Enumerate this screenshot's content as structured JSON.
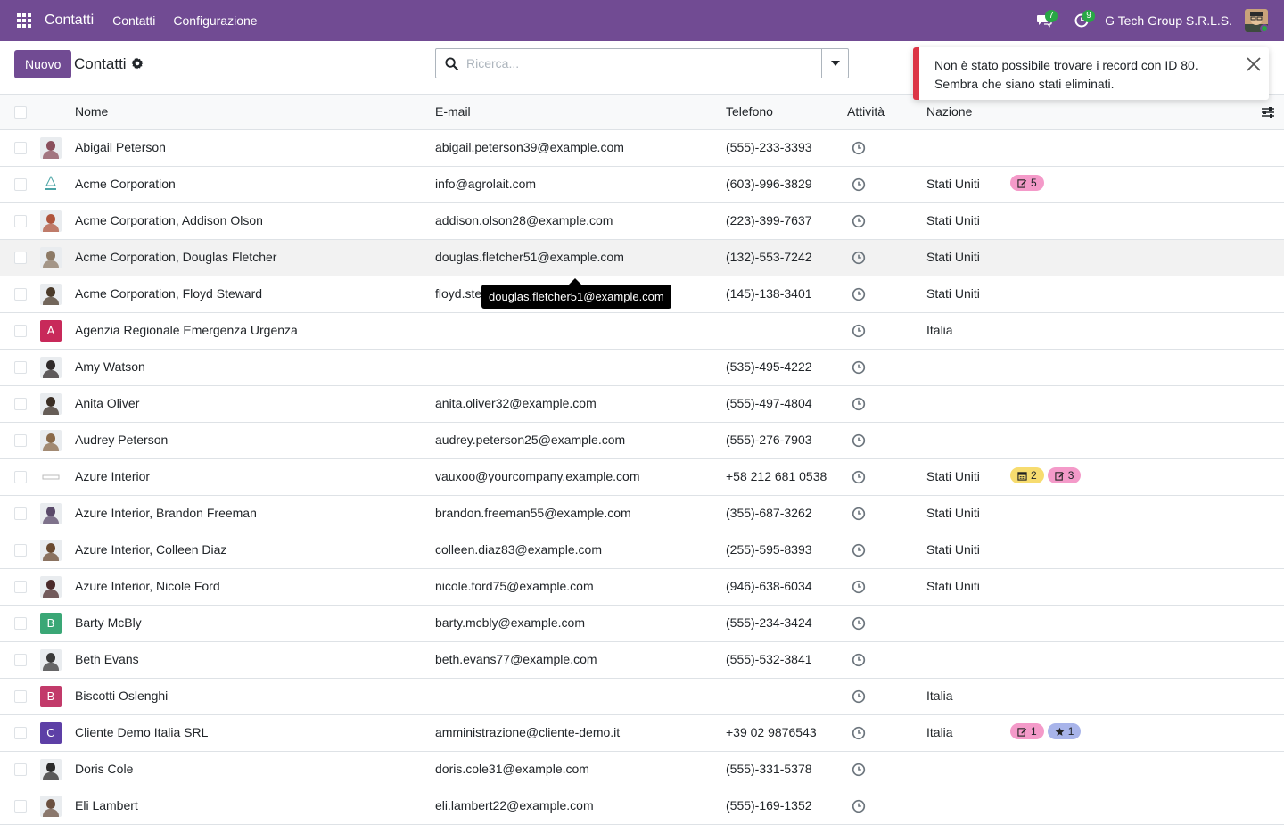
{
  "navbar": {
    "brand": "Contatti",
    "menu": [
      "Contatti",
      "Configurazione"
    ],
    "messages_count": "7",
    "activities_count": "9",
    "company": "G Tech Group S.R.L.S."
  },
  "control_panel": {
    "new_button": "Nuovo",
    "title": "Contatti",
    "search_placeholder": "Ricerca..."
  },
  "notification": {
    "message": "Non è stato possibile trovare i record con ID 80. Sembra che siano stati eliminati."
  },
  "table": {
    "headers": {
      "name": "Nome",
      "email": "E-mail",
      "phone": "Telefono",
      "activity": "Attività",
      "country": "Nazione"
    },
    "rows": [
      {
        "name": "Abigail Peterson",
        "email": "abigail.peterson39@example.com",
        "phone": "(555)-233-3393",
        "country": "",
        "avatar": "photo",
        "color": "#8a4f5c",
        "tags": []
      },
      {
        "name": "Acme Corporation",
        "email": "info@agrolait.com",
        "phone": "(603)-996-3829",
        "country": "Stati Uniti",
        "avatar": "logo-acme",
        "color": "#4aa3a5",
        "tags": [
          {
            "icon": "edit-icon",
            "text": "5",
            "color": "pink"
          }
        ]
      },
      {
        "name": "Acme Corporation, Addison Olson",
        "email": "addison.olson28@example.com",
        "phone": "(223)-399-7637",
        "country": "Stati Uniti",
        "avatar": "photo",
        "color": "#b0553d",
        "tags": []
      },
      {
        "name": "Acme Corporation, Douglas Fletcher",
        "email": "douglas.fletcher51@example.com",
        "phone": "(132)-553-7242",
        "country": "Stati Uniti",
        "avatar": "photo",
        "color": "#8c7a66",
        "tags": [],
        "hover": true
      },
      {
        "name": "Acme Corporation, Floyd Steward",
        "email": "floyd.steward34@example.com",
        "phone": "(145)-138-3401",
        "country": "Stati Uniti",
        "avatar": "photo",
        "color": "#4a3a2a",
        "tags": []
      },
      {
        "name": "Agenzia Regionale Emergenza Urgenza",
        "email": "",
        "phone": "",
        "country": "Italia",
        "avatar": "letter",
        "letter": "A",
        "color": "#c8295a",
        "tags": []
      },
      {
        "name": "Amy Watson",
        "email": "",
        "phone": "(535)-495-4222",
        "country": "",
        "avatar": "photo",
        "color": "#2f2a2a",
        "tags": []
      },
      {
        "name": "Anita Oliver",
        "email": "anita.oliver32@example.com",
        "phone": "(555)-497-4804",
        "country": "",
        "avatar": "photo",
        "color": "#3a2e24",
        "tags": []
      },
      {
        "name": "Audrey Peterson",
        "email": "audrey.peterson25@example.com",
        "phone": "(555)-276-7903",
        "country": "",
        "avatar": "photo",
        "color": "#8a6a4a",
        "tags": []
      },
      {
        "name": "Azure Interior",
        "email": "vauxoo@yourcompany.example.com",
        "phone": "+58 212 681 0538",
        "country": "Stati Uniti",
        "avatar": "logo-azure",
        "color": "#bbbbbb",
        "tags": [
          {
            "icon": "calendar-icon",
            "text": "2",
            "color": "yellow"
          },
          {
            "icon": "edit-icon",
            "text": "3",
            "color": "pink"
          }
        ]
      },
      {
        "name": "Azure Interior, Brandon Freeman",
        "email": "brandon.freeman55@example.com",
        "phone": "(355)-687-3262",
        "country": "Stati Uniti",
        "avatar": "photo",
        "color": "#5a4a6a",
        "tags": []
      },
      {
        "name": "Azure Interior, Colleen Diaz",
        "email": "colleen.diaz83@example.com",
        "phone": "(255)-595-8393",
        "country": "Stati Uniti",
        "avatar": "photo",
        "color": "#6a4a30",
        "tags": []
      },
      {
        "name": "Azure Interior, Nicole Ford",
        "email": "nicole.ford75@example.com",
        "phone": "(946)-638-6034",
        "country": "Stati Uniti",
        "avatar": "photo",
        "color": "#4a2a2a",
        "tags": []
      },
      {
        "name": "Barty McBly",
        "email": "barty.mcbly@example.com",
        "phone": "(555)-234-3424",
        "country": "",
        "avatar": "letter",
        "letter": "B",
        "color": "#3aa776",
        "tags": []
      },
      {
        "name": "Beth Evans",
        "email": "beth.evans77@example.com",
        "phone": "(555)-532-3841",
        "country": "",
        "avatar": "photo",
        "color": "#3a3a3a",
        "tags": []
      },
      {
        "name": "Biscotti Oslenghi",
        "email": "",
        "phone": "",
        "country": "Italia",
        "avatar": "letter",
        "letter": "B",
        "color": "#c23a6a",
        "tags": []
      },
      {
        "name": "Cliente Demo Italia SRL",
        "email": "amministrazione@cliente-demo.it",
        "phone": "+39 02 9876543",
        "country": "Italia",
        "avatar": "letter",
        "letter": "C",
        "color": "#5d3fa6",
        "tags": [
          {
            "icon": "edit-icon",
            "text": "1",
            "color": "pink"
          },
          {
            "icon": "star-icon",
            "text": "1",
            "color": "blue"
          }
        ]
      },
      {
        "name": "Doris Cole",
        "email": "doris.cole31@example.com",
        "phone": "(555)-331-5378",
        "country": "",
        "avatar": "photo",
        "color": "#2a2a2a",
        "tags": []
      },
      {
        "name": "Eli Lambert",
        "email": "eli.lambert22@example.com",
        "phone": "(555)-169-1352",
        "country": "",
        "avatar": "photo",
        "color": "#6a5040",
        "tags": []
      }
    ]
  },
  "tooltip": {
    "text": "douglas.fletcher51@example.com"
  }
}
